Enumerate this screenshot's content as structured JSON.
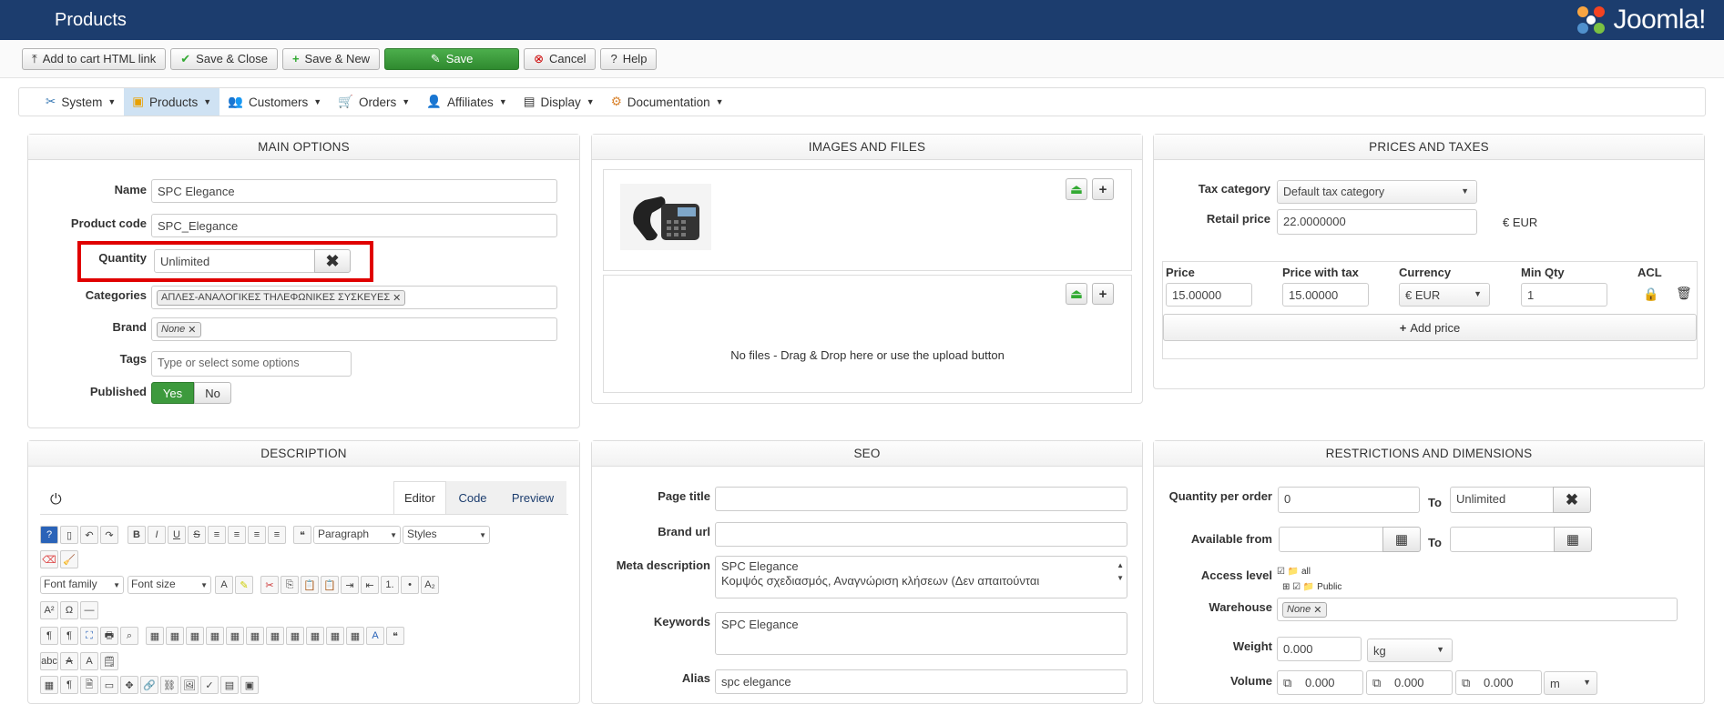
{
  "header": {
    "title": "Products",
    "logo_text": "Joomla!"
  },
  "toolbar": {
    "add_cart": "Add to cart HTML link",
    "save_close": "Save & Close",
    "save_new": "Save & New",
    "save": "Save",
    "cancel": "Cancel",
    "help": "Help"
  },
  "menu": {
    "items": [
      "System",
      "Products",
      "Customers",
      "Orders",
      "Affiliates",
      "Display",
      "Documentation"
    ]
  },
  "main": {
    "title": "MAIN OPTIONS",
    "name_label": "Name",
    "name": "SPC Elegance",
    "code_label": "Product code",
    "code": "SPC_Elegance",
    "qty_label": "Quantity",
    "qty": "Unlimited",
    "cat_label": "Categories",
    "category": "ΑΠΛΕΣ-ΑΝΑΛΟΓΙΚΕΣ ΤΗΛΕΦΩΝΙΚΕΣ ΣΥΣΚΕΥΕΣ",
    "brand_label": "Brand",
    "brand": "None",
    "tags_label": "Tags",
    "tags_placeholder": "Type or select some options",
    "pub_label": "Published",
    "yes": "Yes",
    "no": "No"
  },
  "images": {
    "title": "IMAGES AND FILES",
    "no_files": "No files - Drag & Drop here or use the upload button"
  },
  "prices": {
    "title": "PRICES AND TAXES",
    "tax_label": "Tax category",
    "tax": "Default tax category",
    "retail_label": "Retail price",
    "retail": "22.0000000",
    "retail_unit": "€ EUR",
    "col_price": "Price",
    "col_tax": "Price with tax",
    "col_currency": "Currency",
    "col_minqty": "Min Qty",
    "col_acl": "ACL",
    "price": "15.00000",
    "price_tax": "15.00000",
    "currency": "€ EUR",
    "minqty": "1",
    "add_price": "Add price"
  },
  "desc": {
    "title": "DESCRIPTION",
    "tab_editor": "Editor",
    "tab_code": "Code",
    "tab_preview": "Preview",
    "paragraph": "Paragraph",
    "styles": "Styles",
    "font_family": "Font family",
    "font_size": "Font size"
  },
  "seo": {
    "title": "SEO",
    "page_title_label": "Page title",
    "brand_url_label": "Brand url",
    "meta_label": "Meta description",
    "meta_line1": "SPC Elegance",
    "meta_line2": "Κομψός σχεδιασμός, Αναγνώριση κλήσεων (Δεν απαιτούνται",
    "keywords_label": "Keywords",
    "keywords": "SPC Elegance",
    "alias_label": "Alias",
    "alias": "spc elegance"
  },
  "restr": {
    "title": "RESTRICTIONS AND DIMENSIONS",
    "qpo_label": "Quantity per order",
    "qpo_from": "0",
    "to": "To",
    "qpo_to": "Unlimited",
    "avail_label": "Available from",
    "access_label": "Access level",
    "access_all": "all",
    "access_public": "Public",
    "warehouse_label": "Warehouse",
    "warehouse": "None",
    "weight_label": "Weight",
    "weight": "0.000",
    "weight_unit": "kg",
    "volume_label": "Volume",
    "vol1": "0.000",
    "vol2": "0.000",
    "vol3": "0.000",
    "vol_unit": "m"
  },
  "colors": {
    "header_bg": "#1c3d6e",
    "save_green": "#3d9a3d",
    "highlight_red": "#e00000",
    "active_menu": "#cfe2f3"
  }
}
